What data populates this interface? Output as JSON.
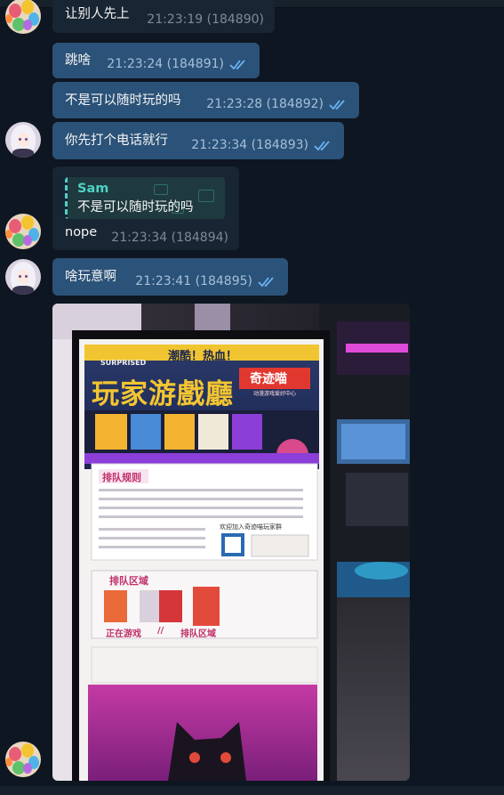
{
  "messages": [
    {
      "id": "m184890",
      "text": "让别人先上",
      "time": "21:23:19 (184890)",
      "direction": "in"
    },
    {
      "id": "m184891",
      "text": "跳啥",
      "time": "21:23:24 (184891)",
      "direction": "out",
      "read": true
    },
    {
      "id": "m184892",
      "text": "不是可以随时玩的吗",
      "time": "21:23:28 (184892)",
      "direction": "out",
      "read": true
    },
    {
      "id": "m184893",
      "text": "你先打个电话就行",
      "time": "21:23:34 (184893)",
      "direction": "out",
      "read": true
    },
    {
      "id": "m184894",
      "text": "nope",
      "time": "21:23:34 (184894)",
      "direction": "in",
      "reply_to": {
        "name": "Sam",
        "text": "不是可以随时玩的吗"
      }
    },
    {
      "id": "m184895",
      "text": "啥玩意啊",
      "time": "21:23:41 (184895)",
      "direction": "out",
      "read": true
    }
  ],
  "photo": {
    "sign": {
      "tag_left": "SURPRISED",
      "slogan": "潮酷！热血！",
      "title": "玩家游戲廳",
      "brand": "奇迹喵",
      "brand_sub": "动漫游戏爱好中心",
      "rules_title": "排队规则",
      "qr_caption": "欢迎加入奇迹喵玩家群",
      "zone_title": "排队区域",
      "playing_label": "正在游戏",
      "separator": "//",
      "queue_label": "排队区域"
    }
  },
  "colors": {
    "background": "#0e1621",
    "bubble_out": "#2b5278",
    "bubble_in": "#182533",
    "reply_accent": "#4fd1c5",
    "check": "#6ab3f3"
  }
}
